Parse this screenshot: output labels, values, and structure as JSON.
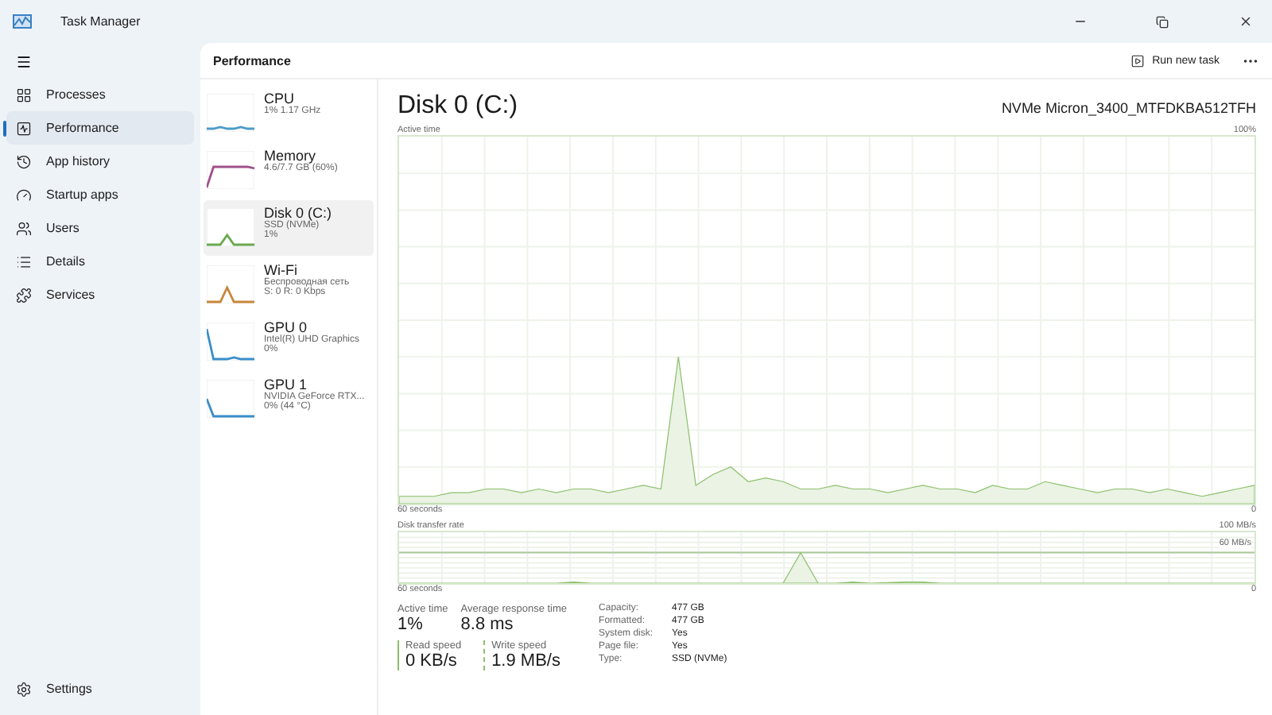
{
  "window": {
    "title": "Task Manager"
  },
  "sidebar": {
    "items": [
      {
        "label": "Processes",
        "selected": false
      },
      {
        "label": "Performance",
        "selected": true
      },
      {
        "label": "App history",
        "selected": false
      },
      {
        "label": "Startup apps",
        "selected": false
      },
      {
        "label": "Users",
        "selected": false
      },
      {
        "label": "Details",
        "selected": false
      },
      {
        "label": "Services",
        "selected": false
      }
    ],
    "footer": {
      "label": "Settings"
    }
  },
  "toolbar": {
    "title": "Performance",
    "action": "Run new task"
  },
  "devices": [
    {
      "name": "CPU",
      "lines": [
        "1% 1.17 GHz"
      ],
      "color": "#4b9bc8",
      "selected": false
    },
    {
      "name": "Memory",
      "lines": [
        "4.6/7.7 GB (60%)"
      ],
      "color": "#a0508a",
      "selected": false
    },
    {
      "name": "Disk 0 (C:)",
      "lines": [
        "SSD (NVMe)",
        "1%"
      ],
      "color": "#6aa84f",
      "selected": true
    },
    {
      "name": "Wi-Fi",
      "lines": [
        "Беспроводная сеть",
        "S: 0 R: 0 Kbps"
      ],
      "color": "#c8873a",
      "selected": false
    },
    {
      "name": "GPU 0",
      "lines": [
        "Intel(R) UHD Graphics",
        "0%"
      ],
      "color": "#3a8ec8",
      "selected": false
    },
    {
      "name": "GPU 1",
      "lines": [
        "NVIDIA GeForce RTX...",
        "0% (44 °C)"
      ],
      "color": "#3a8ec8",
      "selected": false
    }
  ],
  "detail": {
    "title": "Disk 0 (C:)",
    "model": "NVMe Micron_3400_MTFDKBA512TFH",
    "active_chart": {
      "label": "Active time",
      "max": "100%",
      "span": "60 seconds",
      "min": "0"
    },
    "transfer_chart": {
      "label": "Disk transfer rate",
      "max": "100 MB/s",
      "mid": "60 MB/s",
      "span": "60 seconds",
      "min": "0"
    },
    "stats": [
      {
        "label": "Active time",
        "value": "1%"
      },
      {
        "label": "Average response time",
        "value": "8.8 ms"
      }
    ],
    "speeds": [
      {
        "label": "Read speed",
        "value": "0 KB/s",
        "kind": "solid"
      },
      {
        "label": "Write speed",
        "value": "1.9 MB/s",
        "kind": "dashed"
      }
    ],
    "properties": [
      {
        "key": "Capacity:",
        "value": "477 GB"
      },
      {
        "key": "Formatted:",
        "value": "477 GB"
      },
      {
        "key": "System disk:",
        "value": "Yes"
      },
      {
        "key": "Page file:",
        "value": "Yes"
      },
      {
        "key": "Type:",
        "value": "SSD (NVMe)"
      }
    ]
  }
}
